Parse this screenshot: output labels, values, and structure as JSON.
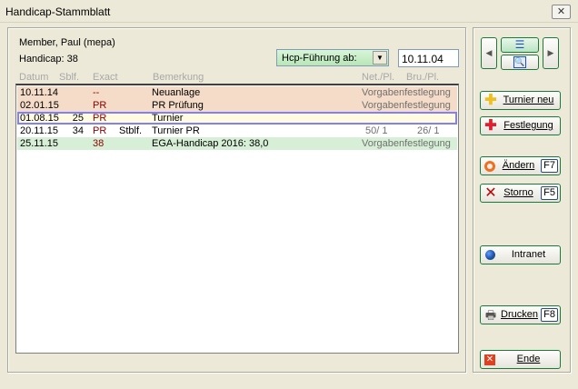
{
  "window": {
    "title": "Handicap-Stammblatt",
    "close": "✕"
  },
  "member": {
    "name": "Member, Paul (mepa)",
    "handicap": "Handicap: 38"
  },
  "filter": {
    "combo": "Hcp-Führung ab:",
    "date": "10.11.04"
  },
  "columns": {
    "datum": "Datum",
    "sblf": "Sblf.",
    "exact": "Exact",
    "bemerkung": "Bemerkung",
    "net": "Net./Pl.",
    "bru": "Bru./Pl."
  },
  "rows": [
    {
      "datum": "10.11.14",
      "sblf": "",
      "exact": "--",
      "type": "",
      "bemerkung": "Neuanlage",
      "net": "Vorgabenfestlegung",
      "bru": "",
      "bg": "#f5dcc8"
    },
    {
      "datum": "02.01.15",
      "sblf": "",
      "exact": "PR",
      "type": "",
      "bemerkung": "PR Prüfung",
      "net": "Vorgabenfestlegung",
      "bru": "",
      "bg": "#f5dcc8"
    },
    {
      "datum": "01.08.15",
      "sblf": "25",
      "exact": "PR",
      "type": "",
      "bemerkung": "Turnier",
      "net": "",
      "bru": "",
      "bg": "#fffbe0"
    },
    {
      "datum": "20.11.15",
      "sblf": "34",
      "exact": "PR",
      "type": "Stblf.",
      "bemerkung": "Turnier PR",
      "net": "50/ 1",
      "bru": "26/ 1",
      "bg": "#ffffff"
    },
    {
      "datum": "25.11.15",
      "sblf": "",
      "exact": "38",
      "type": "",
      "bemerkung": "EGA-Handicap 2016: 38,0",
      "net": "Vorgabenfestlegung",
      "bru": "",
      "bg": "#d6efd6"
    }
  ],
  "buttons": {
    "turnier_neu": "Turnier neu",
    "festlegung": "Festlegung",
    "aendern": "Ändern",
    "aendern_key": "F7",
    "storno": "Storno",
    "storno_key": "F5",
    "intranet": "Intranet",
    "drucken": "Drucken",
    "drucken_key": "F8",
    "ende": "Ende"
  }
}
